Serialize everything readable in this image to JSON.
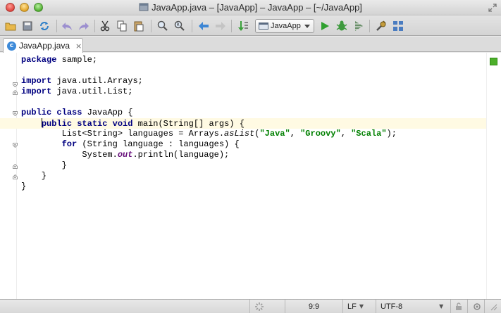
{
  "window": {
    "title": "JavaApp.java – [JavaApp] – JavaApp – [~/JavaApp]"
  },
  "toolbar": {
    "icons": [
      "open-folder-icon",
      "save-icon",
      "sync-icon",
      "undo-icon",
      "redo-icon",
      "cut-icon",
      "copy-icon",
      "paste-icon",
      "find-icon",
      "replace-icon",
      "back-icon",
      "forward-icon",
      "build-icon",
      "run-icon",
      "debug-icon",
      "coverage-icon",
      "settings-icon",
      "project-structure-icon"
    ],
    "run_config": "JavaApp"
  },
  "tabs": [
    {
      "label": "JavaApp.java",
      "icon": "java-class-icon",
      "active": true
    }
  ],
  "editor": {
    "current_line": 6,
    "lines": [
      "package sample;",
      "",
      "import java.util.Arrays;",
      "import java.util.List;",
      "",
      "public class JavaApp {",
      "    public static void main(String[] args) {",
      "        List<String> languages = Arrays.asList(\"Java\", \"Groovy\", \"Scala\");",
      "        for (String language : languages) {",
      "            System.out.println(language);",
      "        }",
      "    }",
      "}"
    ]
  },
  "statusbar": {
    "position": "9:9",
    "line_separator": "LF",
    "encoding": "UTF-8"
  },
  "colors": {
    "keyword": "#000080",
    "string": "#008000",
    "field": "#660e7a",
    "current_line": "#fffae3",
    "inspection_ok": "#4caf2a"
  }
}
